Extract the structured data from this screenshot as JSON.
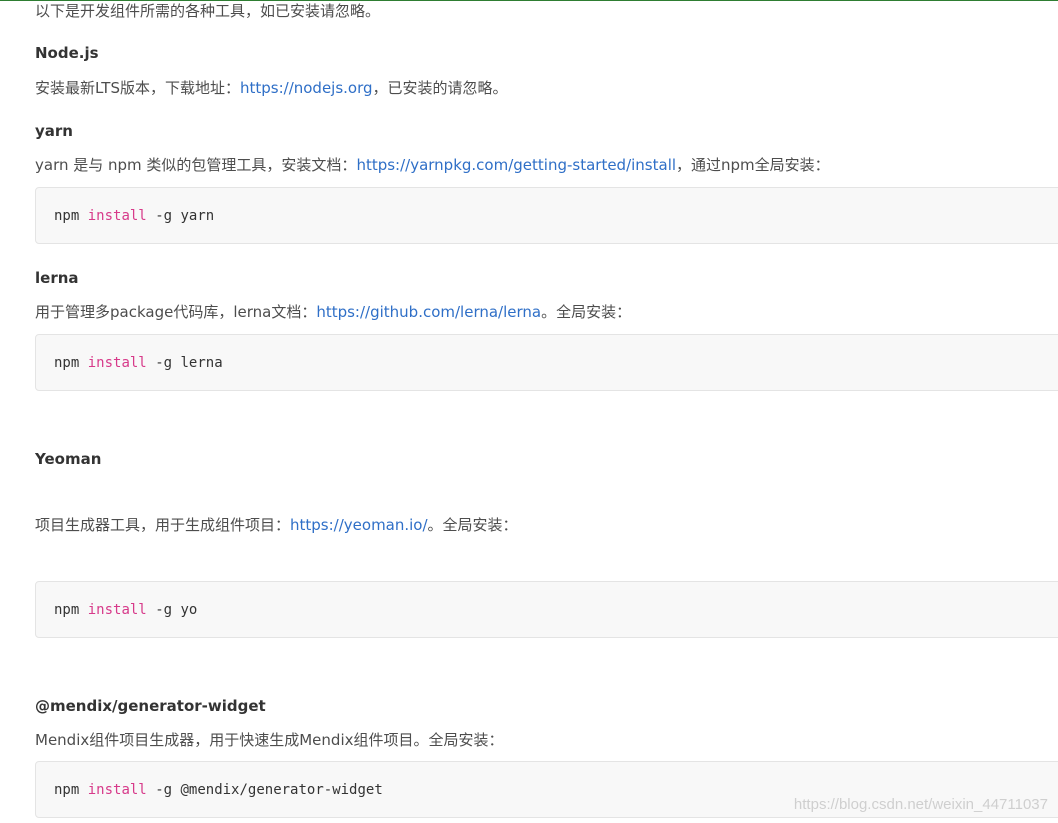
{
  "intro": "以下是开发组件所需的各种工具，如已安装请忽略。",
  "sections": {
    "node": {
      "title": "Node.js",
      "text_before": "安装最新LTS版本，下载地址：",
      "link": "https://nodejs.org",
      "text_after": "，已安装的请忽略。"
    },
    "yarn": {
      "title": "yarn",
      "text_before": "yarn 是与 npm 类似的包管理工具，安装文档：",
      "link": "https://yarnpkg.com/getting-started/install",
      "text_after": "，通过npm全局安装：",
      "code": {
        "cmd": "npm",
        "keyword": "install",
        "args": "-g yarn"
      }
    },
    "lerna": {
      "title": "lerna",
      "text_before": "用于管理多package代码库，lerna文档：",
      "link": "https://github.com/lerna/lerna",
      "text_after": "。全局安装：",
      "code": {
        "cmd": "npm",
        "keyword": "install",
        "args": "-g lerna"
      }
    },
    "yeoman": {
      "title": "Yeoman",
      "text_before": "项目生成器工具，用于生成组件项目：",
      "link": "https://yeoman.io/",
      "text_after": "。全局安装：",
      "code": {
        "cmd": "npm",
        "keyword": "install",
        "args": "-g yo"
      }
    },
    "generator": {
      "title": "@mendix/generator-widget",
      "text": "Mendix组件项目生成器，用于快速生成Mendix组件项目。全局安装：",
      "code": {
        "cmd": "npm",
        "keyword": "install",
        "args": "-g @mendix/generator-widget"
      }
    }
  },
  "watermark": "https://blog.csdn.net/weixin_44711037",
  "colors": {
    "link": "#2f6fc7",
    "keyword": "#d73a8a",
    "code_bg": "#f8f8f8",
    "top_rule": "#2e7d32"
  }
}
